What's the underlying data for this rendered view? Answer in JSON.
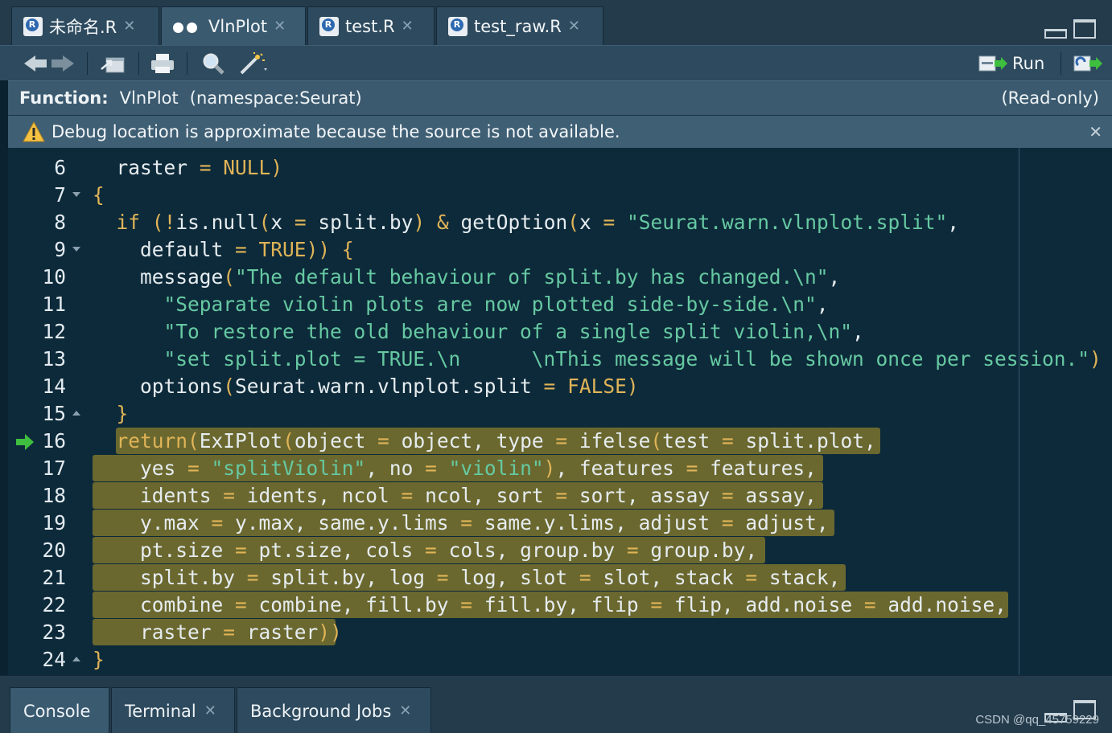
{
  "tabs": [
    {
      "label": "未命名.R",
      "type": "r-file",
      "active": false
    },
    {
      "label": "VlnPlot",
      "type": "viewer",
      "active": true
    },
    {
      "label": "test.R",
      "type": "r-file",
      "active": false
    },
    {
      "label": "test_raw.R",
      "type": "r-file",
      "active": false
    }
  ],
  "toolbar": {
    "run_label": "Run"
  },
  "infobar": {
    "function_label": "Function:",
    "function_name": "VlnPlot",
    "namespace": "(namespace:Seurat)",
    "readonly": "(Read-only)"
  },
  "debugbar": {
    "message": "Debug location is approximate because the source is not available."
  },
  "editor": {
    "current_line": 16,
    "lines": [
      {
        "n": "6",
        "text": "  raster = NULL)"
      },
      {
        "n": "7",
        "text": "{"
      },
      {
        "n": "8",
        "text": "  if (!is.null(x = split.by) & getOption(x = \"Seurat.warn.vlnplot.split\","
      },
      {
        "n": "9",
        "text": "    default = TRUE)) {"
      },
      {
        "n": "10",
        "text": "    message(\"The default behaviour of split.by has changed.\\n\","
      },
      {
        "n": "11",
        "text": "      \"Separate violin plots are now plotted side-by-side.\\n\","
      },
      {
        "n": "12",
        "text": "      \"To restore the old behaviour of a single split violin,\\n\","
      },
      {
        "n": "13",
        "text": "      \"set split.plot = TRUE.\\n      \\nThis message will be shown once per session.\")"
      },
      {
        "n": "14",
        "text": "    options(Seurat.warn.vlnplot.split = FALSE)"
      },
      {
        "n": "15",
        "text": "  }"
      },
      {
        "n": "16",
        "text": "  return(ExIPlot(object = object, type = ifelse(test = split.plot,"
      },
      {
        "n": "17",
        "text": "    yes = \"splitViolin\", no = \"violin\"), features = features,"
      },
      {
        "n": "18",
        "text": "    idents = idents, ncol = ncol, sort = sort, assay = assay,"
      },
      {
        "n": "19",
        "text": "    y.max = y.max, same.y.lims = same.y.lims, adjust = adjust,"
      },
      {
        "n": "20",
        "text": "    pt.size = pt.size, cols = cols, group.by = group.by,"
      },
      {
        "n": "21",
        "text": "    split.by = split.by, log = log, slot = slot, stack = stack,"
      },
      {
        "n": "22",
        "text": "    combine = combine, fill.by = fill.by, flip = flip, add.noise = add.noise,"
      },
      {
        "n": "23",
        "text": "    raster = raster))"
      },
      {
        "n": "24",
        "text": "}"
      }
    ]
  },
  "bottom_tabs": [
    {
      "label": "Console",
      "active": true
    },
    {
      "label": "Terminal",
      "active": false
    },
    {
      "label": "Background Jobs",
      "active": false
    }
  ],
  "watermark": "CSDN @qq_45759229",
  "colors": {
    "background": "#0d2a3a",
    "highlight": "#6a682f",
    "keyword": "#e0b457",
    "string": "#66c9a2",
    "debug_arrow": "#3fbf3f"
  }
}
